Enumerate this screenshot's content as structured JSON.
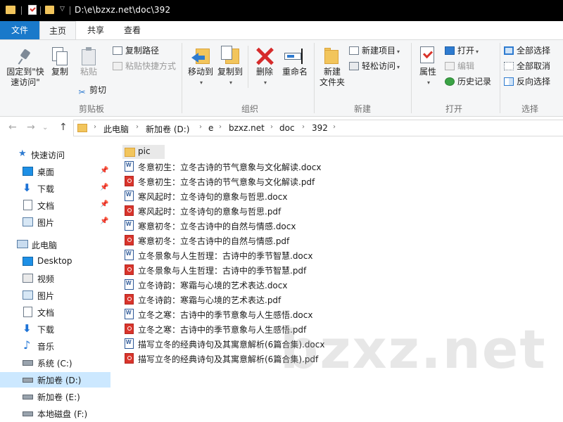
{
  "window": {
    "title": "D:\\e\\bzxz.net\\doc\\392"
  },
  "tabs": {
    "file": "文件",
    "home": "主页",
    "share": "共享",
    "view": "查看"
  },
  "ribbon": {
    "clipboard": {
      "label": "剪贴板",
      "pin": "固定到\"快\n速访问\"",
      "copy": "复制",
      "paste": "粘贴",
      "copy_path": "复制路径",
      "paste_shortcut": "粘贴快捷方式",
      "cut": "剪切"
    },
    "organize": {
      "label": "组织",
      "move_to": "移动到",
      "copy_to": "复制到",
      "delete": "删除",
      "rename": "重命名"
    },
    "new": {
      "label": "新建",
      "new_folder": "新建\n文件夹",
      "new_item": "新建项目",
      "easy_access": "轻松访问"
    },
    "open": {
      "label": "打开",
      "properties": "属性",
      "open": "打开",
      "edit": "编辑",
      "history": "历史记录"
    },
    "select": {
      "label": "选择",
      "select_all": "全部选择",
      "select_none": "全部取消",
      "invert": "反向选择"
    }
  },
  "address": {
    "crumbs": [
      "此电脑",
      "新加卷 (D:)",
      "e",
      "bzxz.net",
      "doc",
      "392"
    ]
  },
  "sidebar": {
    "quick_access": "快速访问",
    "quick_items": [
      "桌面",
      "下载",
      "文档",
      "图片"
    ],
    "this_pc": "此电脑",
    "pc_items": [
      "Desktop",
      "视频",
      "图片",
      "文档",
      "下载",
      "音乐",
      "系统 (C:)",
      "新加卷 (D:)",
      "新加卷 (E:)",
      "本地磁盘 (F:)"
    ]
  },
  "files": [
    {
      "name": "pic",
      "type": "folder"
    },
    {
      "name": "冬意初生：立冬古诗的节气意象与文化解读.docx",
      "type": "docx"
    },
    {
      "name": "冬意初生：立冬古诗的节气意象与文化解读.pdf",
      "type": "pdf"
    },
    {
      "name": "寒风起时：立冬诗句的意象与哲思.docx",
      "type": "docx"
    },
    {
      "name": "寒风起时：立冬诗句的意象与哲思.pdf",
      "type": "pdf"
    },
    {
      "name": "寒意初冬：立冬古诗中的自然与情感.docx",
      "type": "docx"
    },
    {
      "name": "寒意初冬：立冬古诗中的自然与情感.pdf",
      "type": "pdf"
    },
    {
      "name": "立冬景象与人生哲理：古诗中的季节智慧.docx",
      "type": "docx"
    },
    {
      "name": "立冬景象与人生哲理：古诗中的季节智慧.pdf",
      "type": "pdf"
    },
    {
      "name": "立冬诗韵：寒霜与心境的艺术表达.docx",
      "type": "docx"
    },
    {
      "name": "立冬诗韵：寒霜与心境的艺术表达.pdf",
      "type": "pdf"
    },
    {
      "name": "立冬之寒：古诗中的季节意象与人生感悟.docx",
      "type": "docx"
    },
    {
      "name": "立冬之寒：古诗中的季节意象与人生感悟.pdf",
      "type": "pdf"
    },
    {
      "name": "描写立冬的经典诗句及其寓意解析(6篇合集).docx",
      "type": "docx"
    },
    {
      "name": "描写立冬的经典诗句及其寓意解析(6篇合集).pdf",
      "type": "pdf"
    }
  ],
  "watermark": "bzxz.net",
  "colors": {
    "accent": "#1979ca",
    "selection": "#cce8ff",
    "folder": "#f2c55c",
    "pdf": "#d9342b",
    "docx": "#2b5797"
  }
}
